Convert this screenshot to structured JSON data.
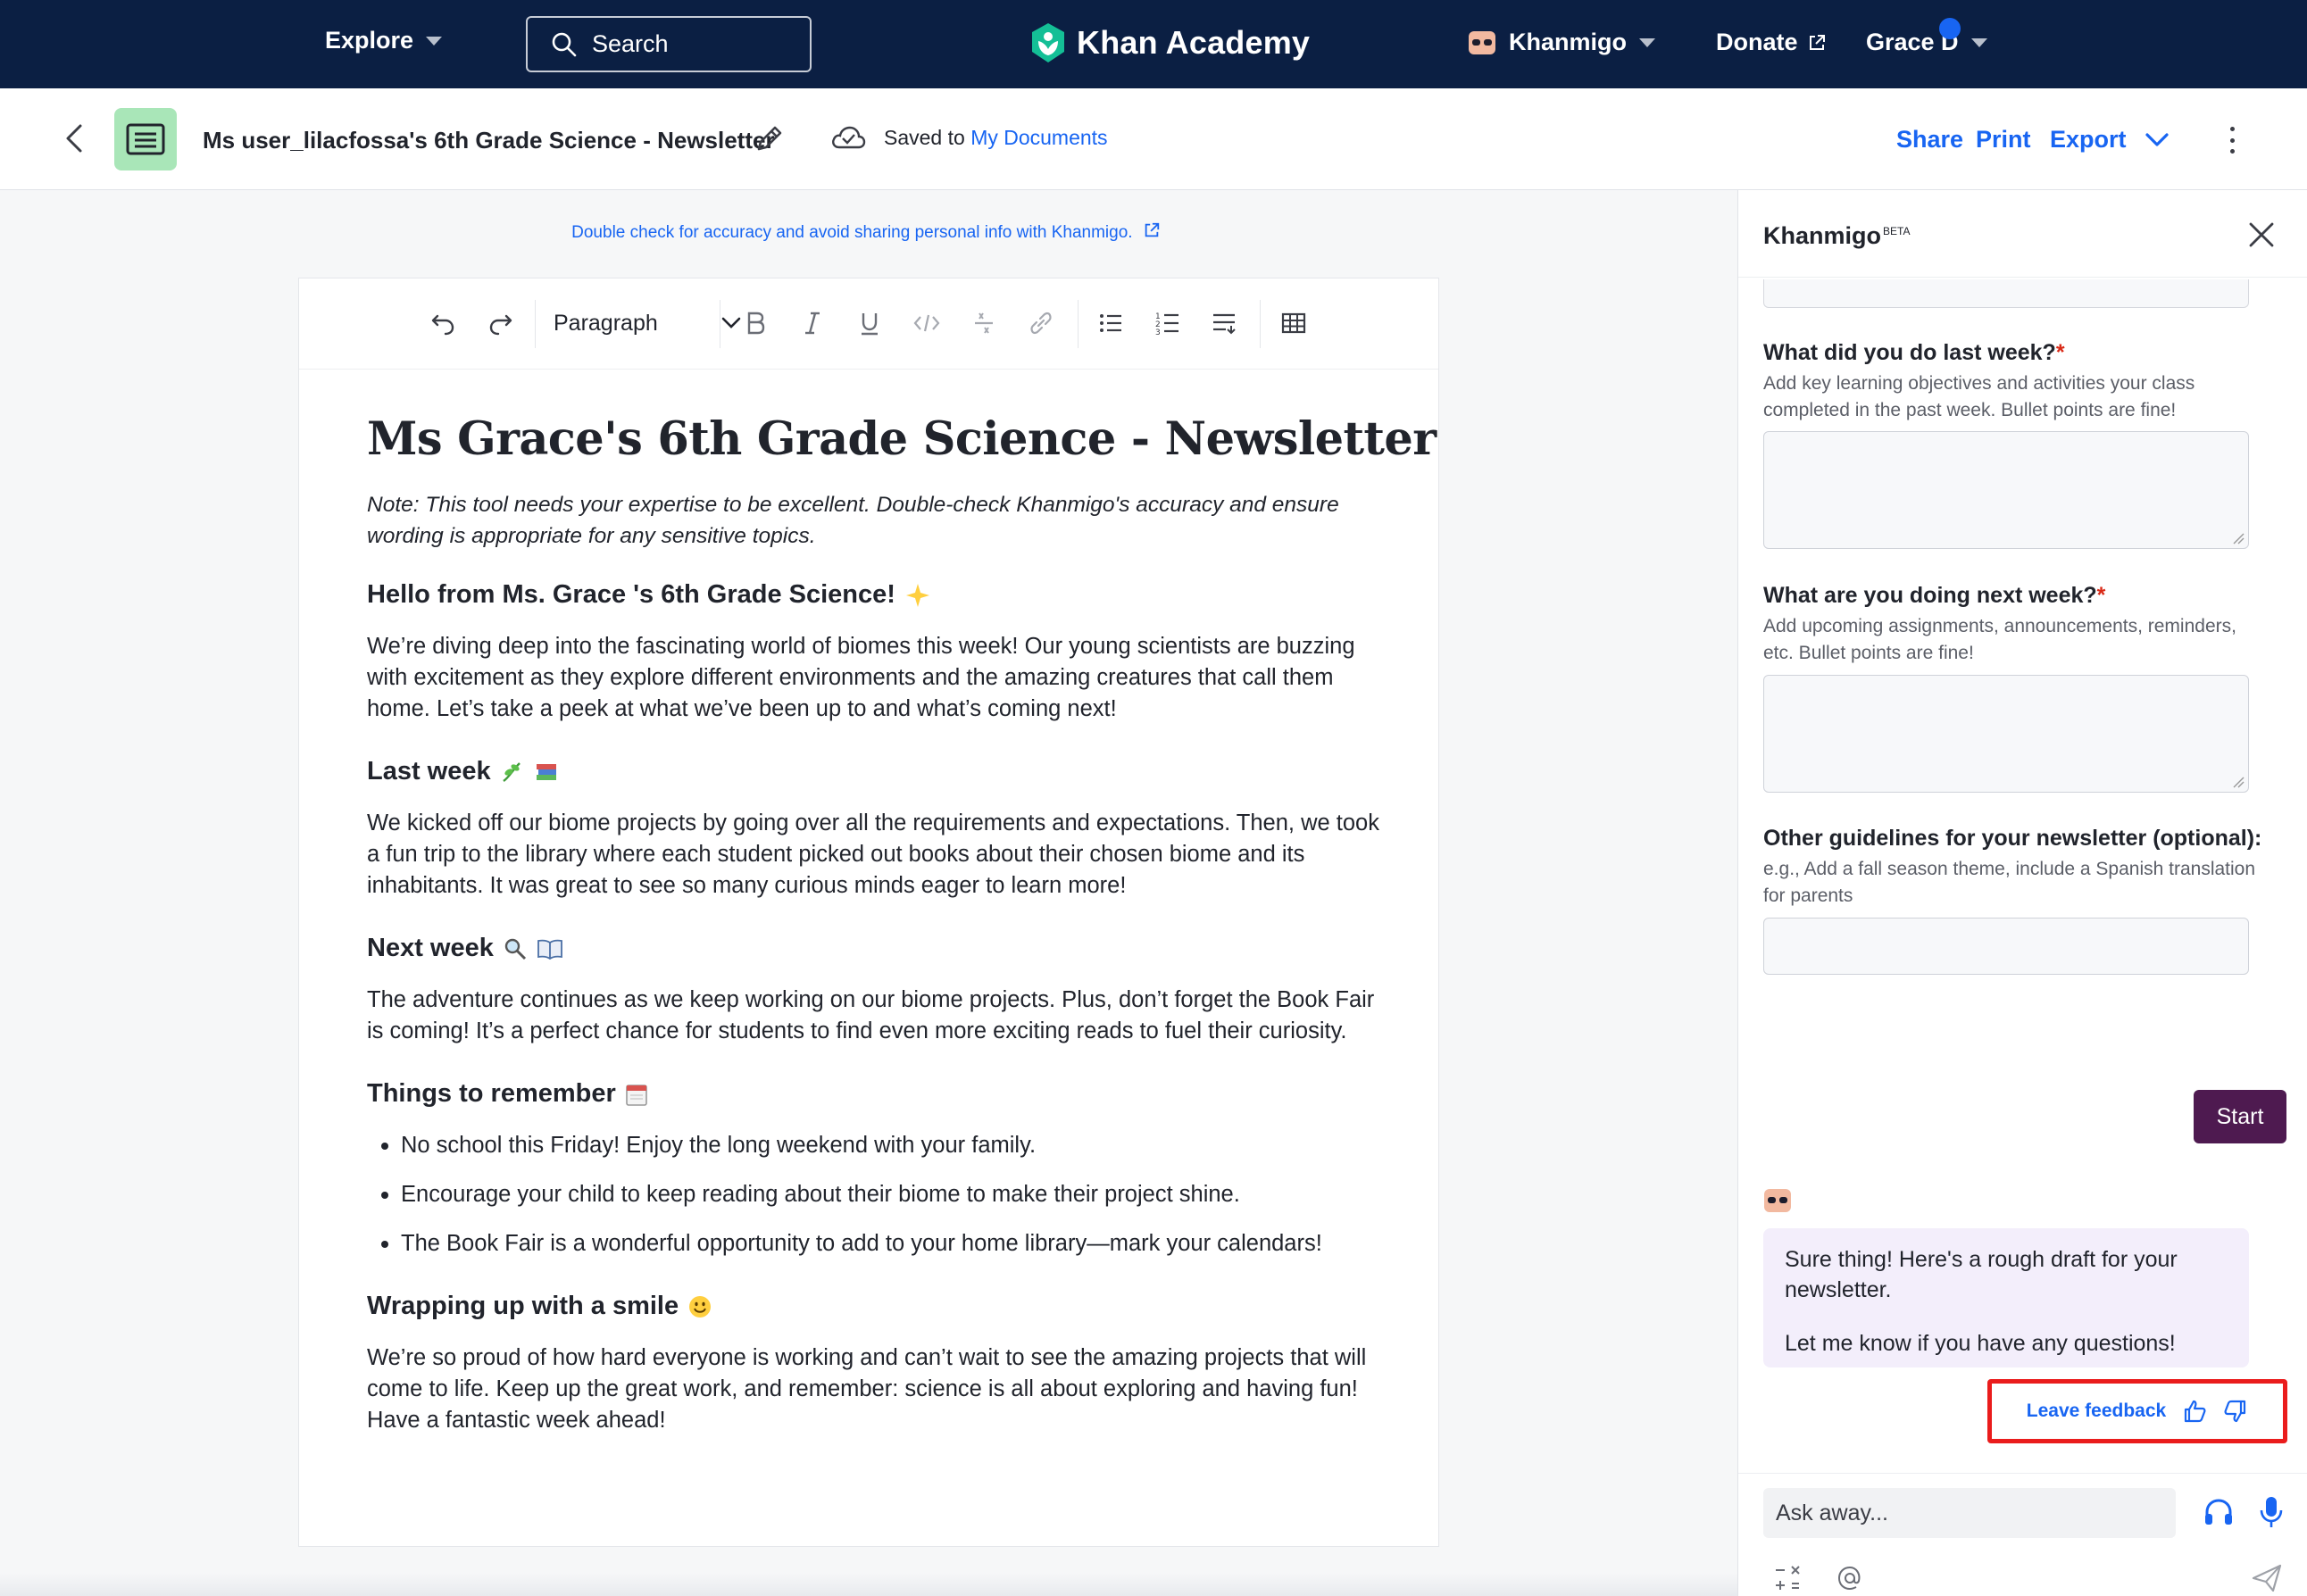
{
  "nav": {
    "explore": "Explore",
    "search_label": "Search",
    "logo_text": "Khan Academy",
    "khanmigo": "Khanmigo",
    "donate": "Donate",
    "user": "Grace D"
  },
  "doc_header": {
    "title": "Ms user_lilacfossa's 6th Grade Science  - Newsletter",
    "saved_prefix": "Saved to",
    "saved_link": "My Documents",
    "share": "Share",
    "print": "Print",
    "export": "Export"
  },
  "editor": {
    "disclaimer": "Double check for accuracy and avoid sharing personal info with Khanmigo.",
    "paragraph_style": "Paragraph",
    "toolbar_icons": [
      "undo-icon",
      "redo-icon",
      "bold-icon",
      "italic-icon",
      "underline-icon",
      "code-icon",
      "clear-format-icon",
      "link-icon",
      "bulleted-list-icon",
      "numbered-list-icon",
      "indent-icon",
      "table-icon"
    ]
  },
  "document": {
    "title": "Ms Grace's 6th Grade Science  - Newsletter",
    "note": "Note: This tool needs your expertise to be excellent. Double-check Khanmigo's accuracy and ensure wording is appropriate for any sensitive topics.",
    "greeting_heading": "Hello from Ms. Grace  's 6th Grade Science!",
    "greeting_text": "We’re diving deep into the fascinating world of biomes this week! Our young scientists are buzzing with excitement as they explore different environments and the amazing creatures that call them home. Let’s take a peek at what we’ve been up to and what’s coming next!",
    "last_week_heading": "Last week",
    "last_week_text": "We kicked off our biome projects by going over all the requirements and expectations. Then, we took a fun trip to the library where each student picked out books about their chosen biome and its inhabitants. It was great to see so many curious minds eager to learn more!",
    "next_week_heading": "Next week",
    "next_week_text": "The adventure continues as we keep working on our biome projects. Plus, don’t forget the Book Fair is coming! It’s a perfect chance for students to find even more exciting reads to fuel their curiosity.",
    "remember_heading": "Things to remember",
    "remember_items": [
      "No school this Friday! Enjoy the long weekend with your family.",
      "Encourage your child to keep reading about their biome to make their project shine.",
      "The Book Fair is a wonderful opportunity to add to your home library—mark your calendars!"
    ],
    "wrap_heading": "Wrapping up with a smile",
    "wrap_text": "We’re so proud of how hard everyone is working and can’t wait to see the amazing projects that will come to life. Keep up the great work, and remember: science is all about exploring and having fun! Have a fantastic week ahead!"
  },
  "panel": {
    "title": "Khanmigo",
    "title_sup": "BETA",
    "q1_label": "What did you do last week?",
    "q1_help": "Add key learning objectives and activities your class completed in the past week. Bullet points are fine!",
    "q2_label": "What are you doing next week?",
    "q2_help": "Add upcoming assignments, announcements, reminders, etc. Bullet points are fine!",
    "q3_label": "Other guidelines for your newsletter (optional):",
    "q3_help": "e.g., Add a fall season theme, include a Spanish translation for parents",
    "required_mark": "*",
    "start": "Start",
    "bot_message_1": "Sure thing! Here's a rough draft for your newsletter.",
    "bot_message_2": "Let me know if you have any questions!",
    "feedback": "Leave feedback",
    "ask_placeholder": "Ask away..."
  },
  "colors": {
    "nav_bg": "#0b1f43",
    "link_blue": "#1865f2",
    "start_button": "#4e1a50",
    "bot_bubble": "#f3eefb",
    "highlight_box": "#ea1c1c",
    "doc_icon_tile": "#a9e6b8"
  }
}
